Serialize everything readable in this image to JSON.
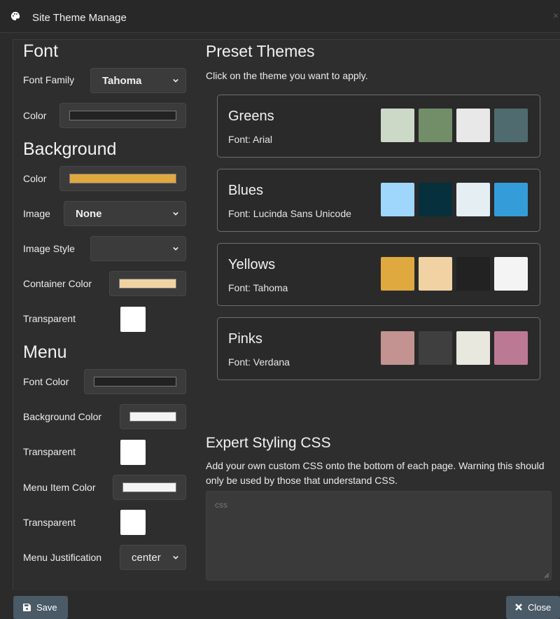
{
  "window": {
    "title": "Site Theme Manage",
    "close_glyph": "×"
  },
  "font_section": {
    "heading": "Font",
    "family_label": "Font Family",
    "family_value": "Tahoma",
    "color_label": "Color",
    "color_value": "#222222"
  },
  "background_section": {
    "heading": "Background",
    "color_label": "Color",
    "color_value": "#e0a93f",
    "image_label": "Image",
    "image_value": "None",
    "image_style_label": "Image Style",
    "image_style_value": "",
    "container_color_label": "Container Color",
    "container_color_value": "#f1d3a3",
    "transparent_label": "Transparent"
  },
  "menu_section": {
    "heading": "Menu",
    "font_color_label": "Font Color",
    "font_color_value": "#222222",
    "background_color_label": "Background Color",
    "background_color_value": "#f4f4f4",
    "transparent_label_1": "Transparent",
    "item_color_label": "Menu Item Color",
    "item_color_value": "#f4f4f4",
    "transparent_label_2": "Transparent",
    "justification_label": "Menu Justification",
    "justification_value": "center"
  },
  "presets": {
    "heading": "Preset Themes",
    "instructions": "Click on the theme you want to apply.",
    "themes": [
      {
        "name": "Greens",
        "font": "Font: Arial",
        "colors": [
          "#cdd9c7",
          "#728e69",
          "#e8e8e8",
          "#4f6b70"
        ]
      },
      {
        "name": "Blues",
        "font": "Font: Lucinda Sans Unicode",
        "colors": [
          "#9fd6fb",
          "#05303c",
          "#e5eef2",
          "#349dd9"
        ]
      },
      {
        "name": "Yellows",
        "font": "Font: Tahoma",
        "colors": [
          "#e0a93f",
          "#f1d3a3",
          "#222222",
          "#f4f4f4"
        ]
      },
      {
        "name": "Pinks",
        "font": "Font: Verdana",
        "colors": [
          "#c39392",
          "#3f3f3f",
          "#e8e8df",
          "#bc7993"
        ]
      }
    ]
  },
  "expert_css": {
    "heading": "Expert Styling CSS",
    "description": "Add your own custom CSS onto the bottom of each page. Warning this should only be used by those that understand CSS.",
    "placeholder": "css"
  },
  "footer": {
    "save_label": "Save",
    "close_label": "Close"
  },
  "icons": {
    "title": "palette-icon",
    "save": "floppy-disk-icon",
    "close": "x-icon"
  }
}
